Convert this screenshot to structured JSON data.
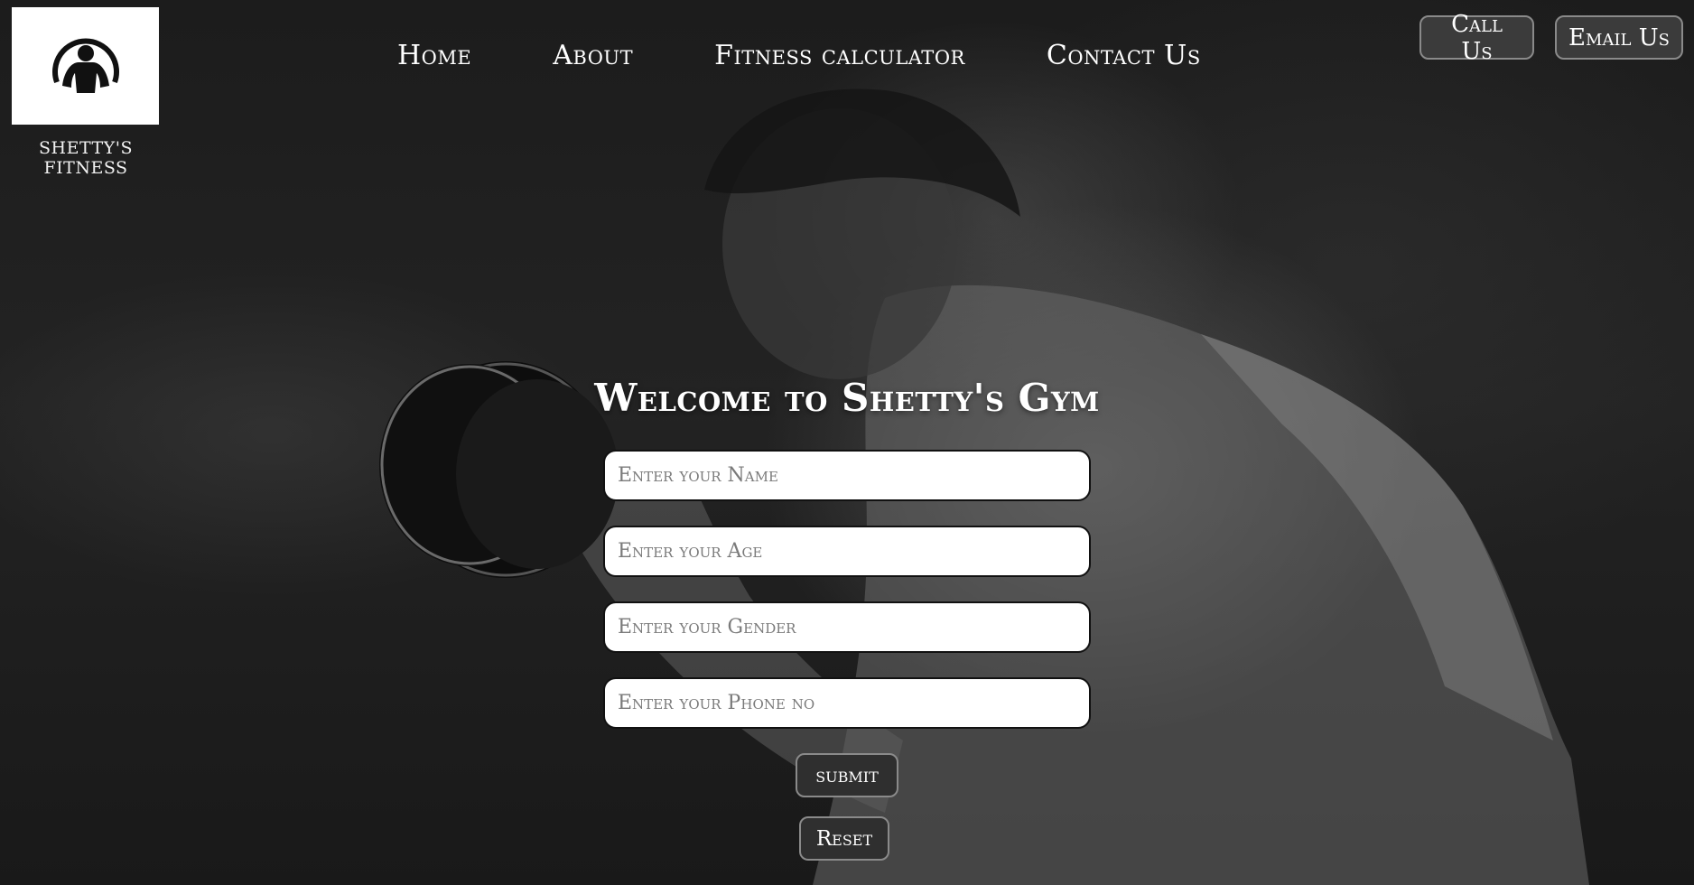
{
  "brand": {
    "caption": "SHETTY'S FITNESS",
    "logo_icon": "bodybuilder-silhouette-icon"
  },
  "nav": {
    "items": [
      {
        "label": "Home"
      },
      {
        "label": "About"
      },
      {
        "label": "Fitness calculator"
      },
      {
        "label": "Contact Us"
      }
    ]
  },
  "header_buttons": {
    "call": "Call Us",
    "email": "Email Us"
  },
  "form": {
    "title": "Welcome to Shetty's Gym",
    "name_placeholder": "Enter your Name",
    "age_placeholder": "Enter your Age",
    "gender_placeholder": "Enter your Gender",
    "phone_placeholder": "Enter your Phone no",
    "submit_label": "submit",
    "reset_label": "Reset"
  },
  "colors": {
    "background": "#1c1c1c",
    "button_bg": "#3b3b3b",
    "button_border": "#8a8a8a",
    "text": "#ffffff"
  }
}
